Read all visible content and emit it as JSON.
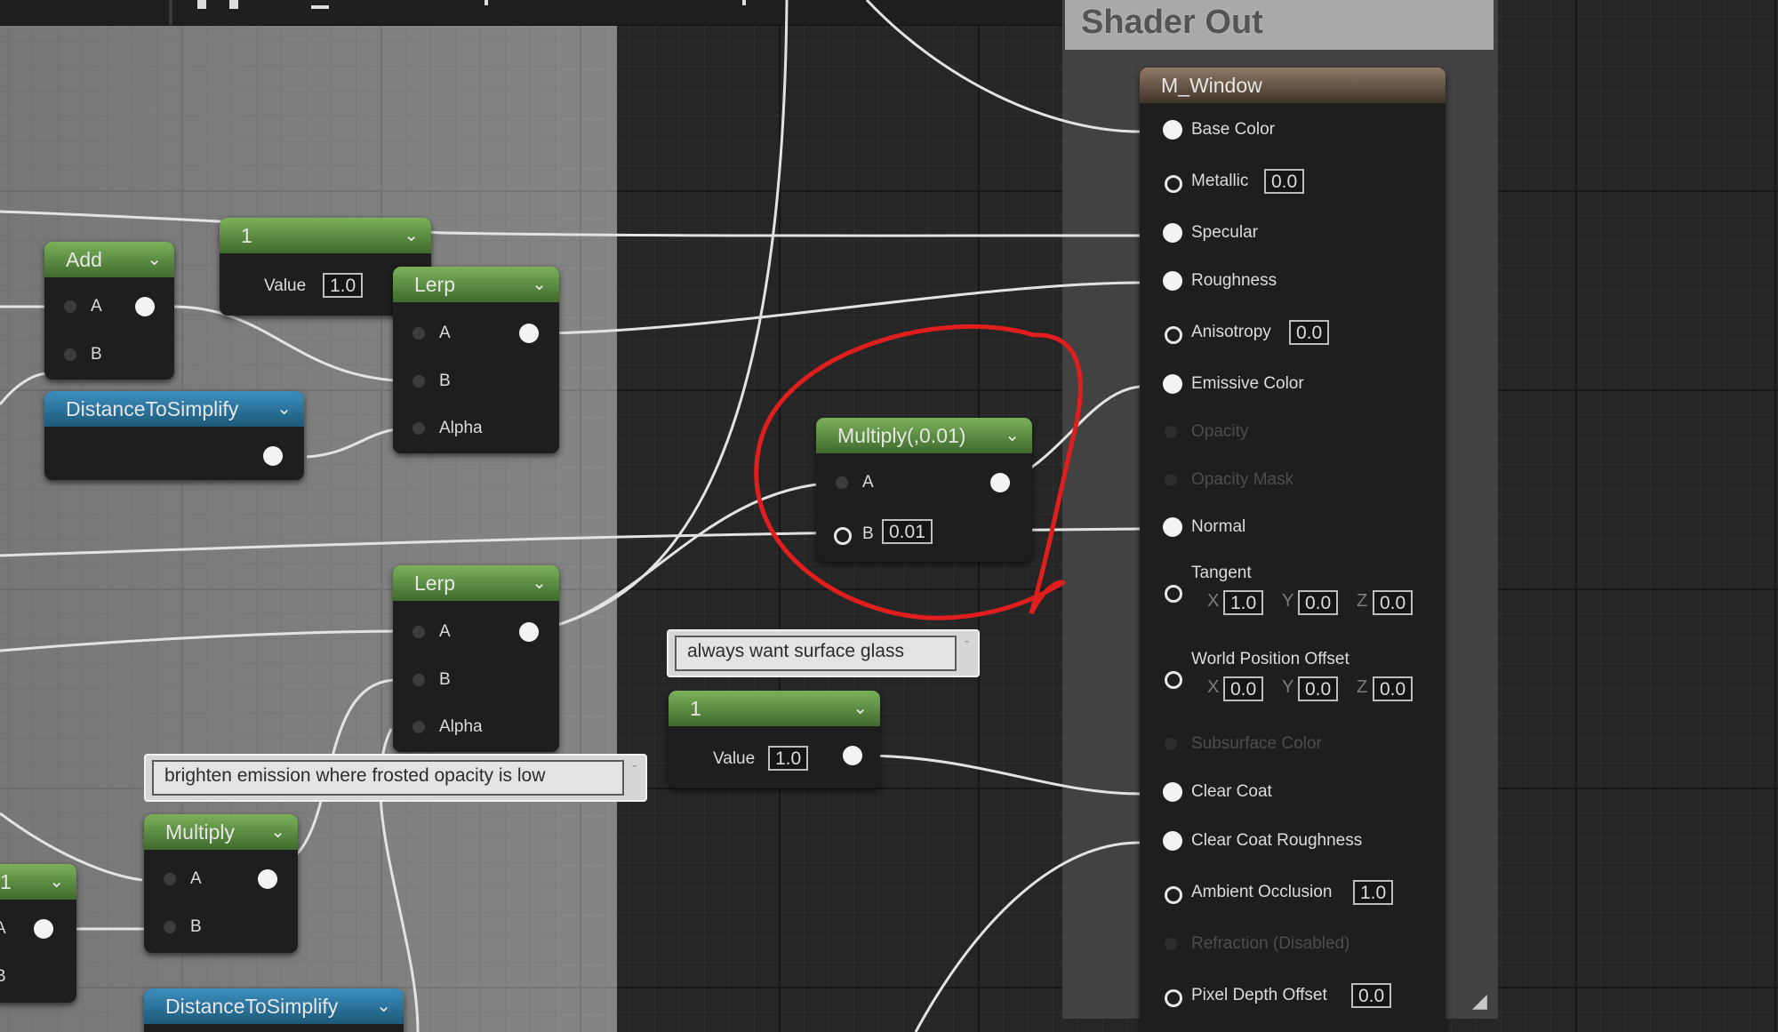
{
  "canvas": {
    "background": "#262626",
    "comment_background": "#858585"
  },
  "shader_out": {
    "title": "Shader Out",
    "node_title": "M_Window",
    "inputs": [
      {
        "label": "Base Color",
        "state": "connected"
      },
      {
        "label": "Metallic",
        "state": "value",
        "value": "0.0"
      },
      {
        "label": "Specular",
        "state": "connected"
      },
      {
        "label": "Roughness",
        "state": "connected"
      },
      {
        "label": "Anisotropy",
        "state": "value",
        "value": "0.0"
      },
      {
        "label": "Emissive Color",
        "state": "connected"
      },
      {
        "label": "Opacity",
        "state": "disabled"
      },
      {
        "label": "Opacity Mask",
        "state": "disabled"
      },
      {
        "label": "Normal",
        "state": "connected"
      },
      {
        "label": "Tangent",
        "state": "vector",
        "x": "1.0",
        "y": "0.0",
        "z": "0.0"
      },
      {
        "label": "World Position Offset",
        "state": "vector",
        "x": "0.0",
        "y": "0.0",
        "z": "0.0"
      },
      {
        "label": "Subsurface Color",
        "state": "disabled"
      },
      {
        "label": "Clear Coat",
        "state": "connected"
      },
      {
        "label": "Clear Coat Roughness",
        "state": "connected"
      },
      {
        "label": "Ambient Occlusion",
        "state": "value",
        "value": "1.0"
      },
      {
        "label": "Refraction (Disabled)",
        "state": "disabled"
      },
      {
        "label": "Pixel Depth Offset",
        "state": "value",
        "value": "0.0"
      }
    ],
    "axis_labels": {
      "x": "X",
      "y": "Y",
      "z": "Z"
    }
  },
  "nodes": {
    "add": {
      "title": "Add",
      "pin_a": "A",
      "pin_b": "B"
    },
    "const_top": {
      "title": "1",
      "value_label": "Value",
      "value": "1.0"
    },
    "lerp_top": {
      "title": "Lerp",
      "pin_a": "A",
      "pin_b": "B",
      "pin_alpha": "Alpha"
    },
    "distance_top": {
      "title": "DistanceToSimplify"
    },
    "multiply_001": {
      "title": "Multiply(,0.01)",
      "pin_a": "A",
      "pin_b": "B",
      "b_value": "0.01"
    },
    "lerp_bottom": {
      "title": "Lerp",
      "pin_a": "A",
      "pin_b": "B",
      "pin_alpha": "Alpha"
    },
    "const_bottom": {
      "title": "1",
      "value_label": "Value",
      "value": "1.0"
    },
    "multiply": {
      "title": "Multiply",
      "pin_a": "A",
      "pin_b": "B"
    },
    "distance_bottom": {
      "title": "DistanceToSimplify"
    },
    "partial_left": {
      "title": "1",
      "pin_a": "A",
      "pin_b": "B"
    }
  },
  "comments": {
    "surface_glass": "always want surface glass",
    "brighten_emission": "brighten emission where frosted opacity is low"
  },
  "annotation": {
    "color": "#e01e1e"
  },
  "icons": {
    "chevron": "chevron-down-icon",
    "pin": "pin-icon",
    "resize": "resize-handle-icon"
  },
  "glyphs": {
    "chevron": "⌄",
    "tack": "⁃",
    "resize": "◢"
  }
}
